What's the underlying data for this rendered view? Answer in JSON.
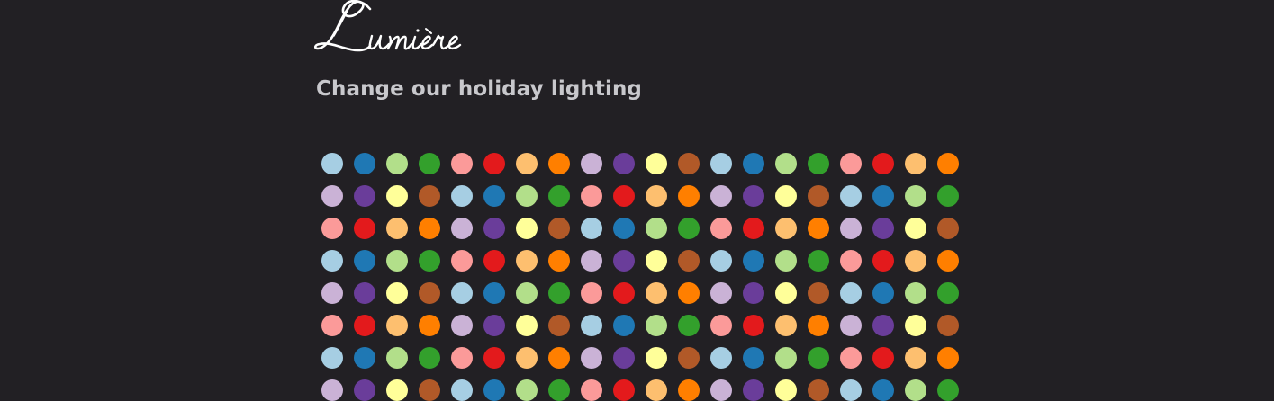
{
  "brand": {
    "logo_text": "Lumière"
  },
  "subtitle": "Change our holiday lighting",
  "colors": {
    "background": "#222024",
    "subtitle_text": "#c8c8cc",
    "logo": "#ffffff"
  },
  "lights": {
    "palette": [
      "#a6cee3",
      "#1f78b4",
      "#b2df8a",
      "#33a02c",
      "#fb9a99",
      "#e31a1c",
      "#fdbf6f",
      "#ff7f00",
      "#cab2d6",
      "#6a3d9a",
      "#ffff99",
      "#b15928"
    ],
    "columns": 20,
    "rows": 8
  }
}
